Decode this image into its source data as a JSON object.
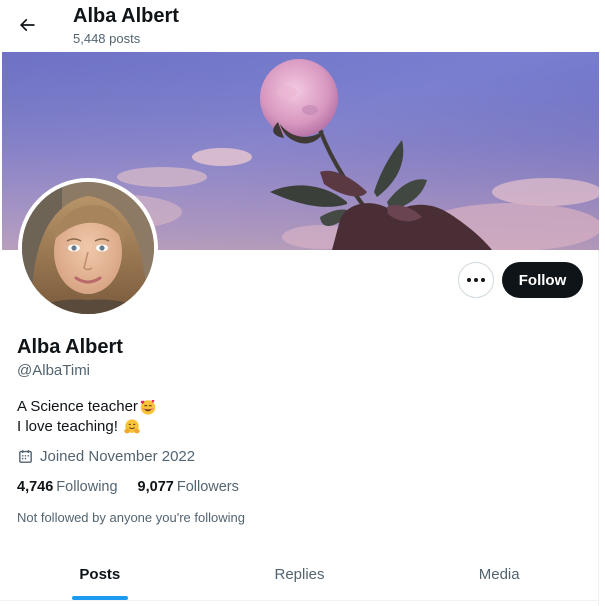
{
  "header": {
    "name": "Alba Albert",
    "post_count": "5,448 posts"
  },
  "profile": {
    "display_name": "Alba Albert",
    "handle": "@AlbaTimi",
    "bio_line_1": "A Science teacher",
    "bio_line_2": "I love teaching! ",
    "joined": "Joined November 2022",
    "following_count": "4,746",
    "following_label": "Following",
    "followers_count": "9,077",
    "followers_label": "Followers",
    "not_followed_note": "Not followed by anyone you're following"
  },
  "actions": {
    "follow_label": "Follow",
    "more_icon": "more-options-icon"
  },
  "tabs": [
    {
      "label": "Posts",
      "active": true
    },
    {
      "label": "Replies",
      "active": false
    },
    {
      "label": "Media",
      "active": false
    }
  ],
  "colors": {
    "accent": "#1d9bf0",
    "follow_button": "#0f1419",
    "secondary_text": "#536471"
  }
}
